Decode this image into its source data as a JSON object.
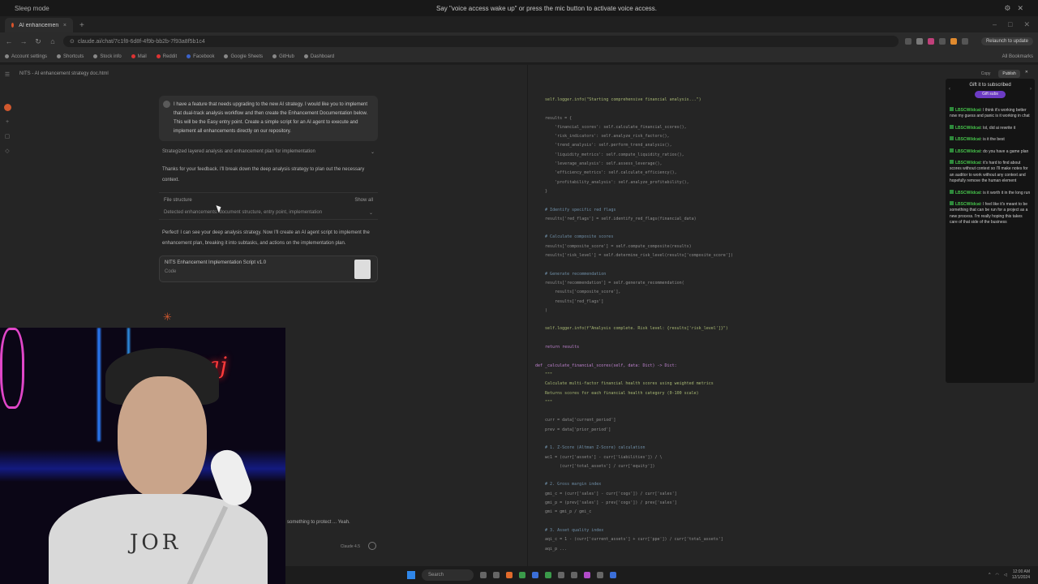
{
  "os": {
    "mode": "Sleep mode",
    "message": "Say \"voice access wake up\" or press the mic button to activate voice access."
  },
  "browser": {
    "tab_title": "AI enhancement strategy doc",
    "url": "claude.ai/chat/7c1f8-6d8f-4f9b-bb2b-7f93a8f5b1c4",
    "profile": "Relaunch to update",
    "bookmarks": [
      "Account settings",
      "Shortcuts",
      "Stock info",
      "Mail",
      "Reddit",
      "Facebook",
      "Google Sheets",
      "GitHub",
      "Dashboard"
    ],
    "all_bookmarks": "All Bookmarks"
  },
  "app": {
    "doc_title": "NITS - AI enhancement strategy doc.html",
    "user_message": "I have a feature that needs upgrading to the new AI strategy. I would like you to implement that dual-track analysis workflow and then create the Enhancement Documentation below. This will be the Easy entry point. Create a simple script for an AI agent to execute and implement all enhancements directly on our repository.",
    "strategized": "Strategized layered analysis and enhancement plan for implementation",
    "reply": "Thanks for your feedback. I'll break down the deep analysis strategy to plan out the necessary context.",
    "files_label": "File structure",
    "files_meta": "Show all",
    "files_sub": "Detected enhancements: document structure, entry point, implementation",
    "perfect": "Perfect! I can see your deep analysis strategy. Now I'll create an AI agent script to implement the enhancement plan, breaking it into subtasks, and actions on the implementation plan.",
    "artifact_title": "NITS Enhancement Implementation Script v1.0",
    "artifact_sub": "Code",
    "input_text": "something to protect ... Yeah.",
    "model": "Claude 4.5",
    "copy": "Copy",
    "publish": "Publish"
  },
  "code_lines": [
    {
      "t": "    self.logger.info(\"Starting comprehensive financial analysis...\")",
      "k": "s"
    },
    {
      "t": "",
      "k": ""
    },
    {
      "t": "    results = {",
      "k": ""
    },
    {
      "t": "        'financial_scores': self.calculate_financial_scores(),",
      "k": ""
    },
    {
      "t": "        'risk_indicators': self.analyze_risk_factors(),",
      "k": ""
    },
    {
      "t": "        'trend_analysis': self.perform_trend_analysis(),",
      "k": ""
    },
    {
      "t": "        'liquidity_metrics': self.compute_liquidity_ratios(),",
      "k": ""
    },
    {
      "t": "        'leverage_analysis': self.assess_leverage(),",
      "k": ""
    },
    {
      "t": "        'efficiency_metrics': self.calculate_efficiency(),",
      "k": ""
    },
    {
      "t": "        'profitability_analysis': self.analyze_profitability(),",
      "k": ""
    },
    {
      "t": "    }",
      "k": ""
    },
    {
      "t": "",
      "k": ""
    },
    {
      "t": "    # Identify specific red flags",
      "k": "c"
    },
    {
      "t": "    results['red_flags'] = self.identify_red_flags(financial_data)",
      "k": ""
    },
    {
      "t": "",
      "k": ""
    },
    {
      "t": "    # Calculate composite scores",
      "k": "c"
    },
    {
      "t": "    results['composite_score'] = self.compute_composite(results)",
      "k": ""
    },
    {
      "t": "    results['risk_level'] = self.determine_risk_level(results['composite_score'])",
      "k": ""
    },
    {
      "t": "",
      "k": ""
    },
    {
      "t": "    # Generate recommendation",
      "k": "c"
    },
    {
      "t": "    results['recommendation'] = self.generate_recommendation(",
      "k": ""
    },
    {
      "t": "        results['composite_score'],",
      "k": ""
    },
    {
      "t": "        results['red_flags']",
      "k": ""
    },
    {
      "t": "    )",
      "k": ""
    },
    {
      "t": "",
      "k": ""
    },
    {
      "t": "    self.logger.info(f\"Analysis complete. Risk level: {results['risk_level']}\")",
      "k": "s"
    },
    {
      "t": "",
      "k": ""
    },
    {
      "t": "    return results",
      "k": "k"
    },
    {
      "t": "",
      "k": ""
    },
    {
      "t": "def _calculate_financial_scores(self, data: Dict) -> Dict:",
      "k": "k"
    },
    {
      "t": "    \"\"\"",
      "k": "s"
    },
    {
      "t": "    Calculate multi-factor financial health scores using weighted metrics",
      "k": "s"
    },
    {
      "t": "    Returns scores for each financial health category (0-100 scale)",
      "k": "s"
    },
    {
      "t": "    \"\"\"",
      "k": "s"
    },
    {
      "t": "",
      "k": ""
    },
    {
      "t": "    curr = data['current_period']",
      "k": ""
    },
    {
      "t": "    prev = data['prior_period']",
      "k": ""
    },
    {
      "t": "",
      "k": ""
    },
    {
      "t": "    # 1. Z-Score (Altman Z-Score) calculation",
      "k": "c"
    },
    {
      "t": "    wc1 = (curr['assets'] - curr['liabilities']) / \\",
      "k": ""
    },
    {
      "t": "          (curr['total_assets'] / curr['equity'])",
      "k": ""
    },
    {
      "t": "",
      "k": ""
    },
    {
      "t": "    # 2. Gross margin index",
      "k": "c"
    },
    {
      "t": "    gmi_c = (curr['sales'] - curr['cogs']) / curr['sales']",
      "k": ""
    },
    {
      "t": "    gmi_p = (prev['sales'] - prev['cogs']) / prev['sales']",
      "k": ""
    },
    {
      "t": "    gmi = gmi_p / gmi_c",
      "k": ""
    },
    {
      "t": "",
      "k": ""
    },
    {
      "t": "    # 3. Asset quality index",
      "k": "c"
    },
    {
      "t": "    aqi_c = 1 - (curr['current_assets'] + curr['ppe']) / curr['total_assets']",
      "k": ""
    },
    {
      "t": "    aqi_p ...",
      "k": ""
    }
  ],
  "twitch": {
    "header": "Gift it to subscribed",
    "badge": "Gift subs",
    "messages": [
      {
        "user": "LBSCWildcat",
        "text": "I think it's working better now my guess and panic is it working in chat"
      },
      {
        "user": "LBSCWildcat",
        "text": "lol, did ai rewrite it"
      },
      {
        "user": "LBSCWildcat",
        "text": "is it the best"
      },
      {
        "user": "LBSCWildcat",
        "text": "do you have a game plan"
      },
      {
        "user": "LBSCWildcat",
        "text": "it's hard to find about scores without context so I'll make notes for an auditor to work without any context and hopefully remove the human element"
      },
      {
        "user": "LBSCWildcat",
        "text": "is it worth it in the long run"
      },
      {
        "user": "LBSCWildcat",
        "text": "I feel like it's meant to be something that can be run for a project as a new process. I'm really hoping this takes care of that side of the business"
      }
    ]
  },
  "cam": {
    "neon_sign": "maj",
    "shirt": "JOR"
  },
  "taskbar": {
    "search": "Search",
    "time": "12:00 AM",
    "date": "12/1/2024"
  }
}
